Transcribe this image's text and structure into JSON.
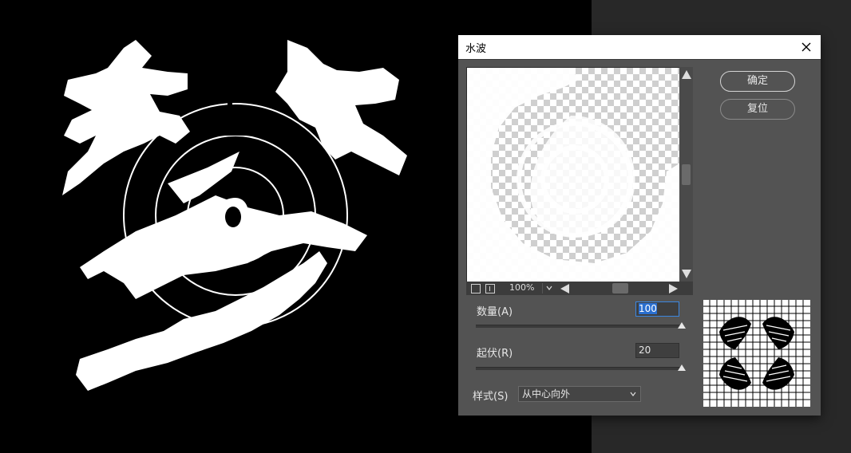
{
  "dialog": {
    "title": "水波",
    "ok_label": "确定",
    "reset_label": "复位"
  },
  "preview": {
    "zoom_level": "100%"
  },
  "controls": {
    "amount_label": "数量(A)",
    "amount_value": "100",
    "amount_slider_fraction": 1.0,
    "ripple_label": "起伏(R)",
    "ripple_value": "20",
    "ripple_slider_fraction": 1.0,
    "style_label": "样式(S)",
    "style_selected": "从中心向外"
  },
  "colors": {
    "dialog_bg": "#535353",
    "canvas_bg": "#000000",
    "panel_bg": "#282828",
    "highlight": "#2a6fd0"
  }
}
